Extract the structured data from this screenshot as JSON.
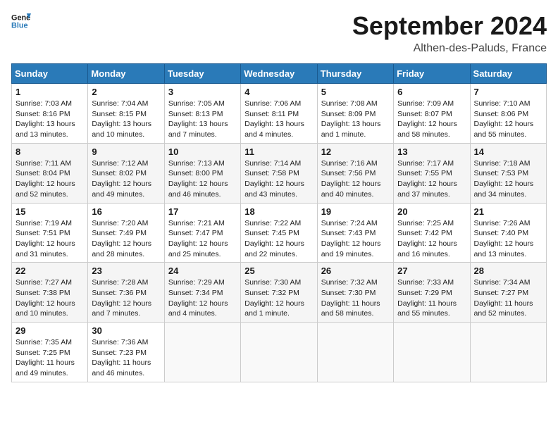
{
  "header": {
    "logo_line1": "General",
    "logo_line2": "Blue",
    "month_year": "September 2024",
    "location": "Althen-des-Paluds, France"
  },
  "weekdays": [
    "Sunday",
    "Monday",
    "Tuesday",
    "Wednesday",
    "Thursday",
    "Friday",
    "Saturday"
  ],
  "weeks": [
    [
      {
        "day": "1",
        "info": "Sunrise: 7:03 AM\nSunset: 8:16 PM\nDaylight: 13 hours\nand 13 minutes."
      },
      {
        "day": "2",
        "info": "Sunrise: 7:04 AM\nSunset: 8:15 PM\nDaylight: 13 hours\nand 10 minutes."
      },
      {
        "day": "3",
        "info": "Sunrise: 7:05 AM\nSunset: 8:13 PM\nDaylight: 13 hours\nand 7 minutes."
      },
      {
        "day": "4",
        "info": "Sunrise: 7:06 AM\nSunset: 8:11 PM\nDaylight: 13 hours\nand 4 minutes."
      },
      {
        "day": "5",
        "info": "Sunrise: 7:08 AM\nSunset: 8:09 PM\nDaylight: 13 hours\nand 1 minute."
      },
      {
        "day": "6",
        "info": "Sunrise: 7:09 AM\nSunset: 8:07 PM\nDaylight: 12 hours\nand 58 minutes."
      },
      {
        "day": "7",
        "info": "Sunrise: 7:10 AM\nSunset: 8:06 PM\nDaylight: 12 hours\nand 55 minutes."
      }
    ],
    [
      {
        "day": "8",
        "info": "Sunrise: 7:11 AM\nSunset: 8:04 PM\nDaylight: 12 hours\nand 52 minutes."
      },
      {
        "day": "9",
        "info": "Sunrise: 7:12 AM\nSunset: 8:02 PM\nDaylight: 12 hours\nand 49 minutes."
      },
      {
        "day": "10",
        "info": "Sunrise: 7:13 AM\nSunset: 8:00 PM\nDaylight: 12 hours\nand 46 minutes."
      },
      {
        "day": "11",
        "info": "Sunrise: 7:14 AM\nSunset: 7:58 PM\nDaylight: 12 hours\nand 43 minutes."
      },
      {
        "day": "12",
        "info": "Sunrise: 7:16 AM\nSunset: 7:56 PM\nDaylight: 12 hours\nand 40 minutes."
      },
      {
        "day": "13",
        "info": "Sunrise: 7:17 AM\nSunset: 7:55 PM\nDaylight: 12 hours\nand 37 minutes."
      },
      {
        "day": "14",
        "info": "Sunrise: 7:18 AM\nSunset: 7:53 PM\nDaylight: 12 hours\nand 34 minutes."
      }
    ],
    [
      {
        "day": "15",
        "info": "Sunrise: 7:19 AM\nSunset: 7:51 PM\nDaylight: 12 hours\nand 31 minutes."
      },
      {
        "day": "16",
        "info": "Sunrise: 7:20 AM\nSunset: 7:49 PM\nDaylight: 12 hours\nand 28 minutes."
      },
      {
        "day": "17",
        "info": "Sunrise: 7:21 AM\nSunset: 7:47 PM\nDaylight: 12 hours\nand 25 minutes."
      },
      {
        "day": "18",
        "info": "Sunrise: 7:22 AM\nSunset: 7:45 PM\nDaylight: 12 hours\nand 22 minutes."
      },
      {
        "day": "19",
        "info": "Sunrise: 7:24 AM\nSunset: 7:43 PM\nDaylight: 12 hours\nand 19 minutes."
      },
      {
        "day": "20",
        "info": "Sunrise: 7:25 AM\nSunset: 7:42 PM\nDaylight: 12 hours\nand 16 minutes."
      },
      {
        "day": "21",
        "info": "Sunrise: 7:26 AM\nSunset: 7:40 PM\nDaylight: 12 hours\nand 13 minutes."
      }
    ],
    [
      {
        "day": "22",
        "info": "Sunrise: 7:27 AM\nSunset: 7:38 PM\nDaylight: 12 hours\nand 10 minutes."
      },
      {
        "day": "23",
        "info": "Sunrise: 7:28 AM\nSunset: 7:36 PM\nDaylight: 12 hours\nand 7 minutes."
      },
      {
        "day": "24",
        "info": "Sunrise: 7:29 AM\nSunset: 7:34 PM\nDaylight: 12 hours\nand 4 minutes."
      },
      {
        "day": "25",
        "info": "Sunrise: 7:30 AM\nSunset: 7:32 PM\nDaylight: 12 hours\nand 1 minute."
      },
      {
        "day": "26",
        "info": "Sunrise: 7:32 AM\nSunset: 7:30 PM\nDaylight: 11 hours\nand 58 minutes."
      },
      {
        "day": "27",
        "info": "Sunrise: 7:33 AM\nSunset: 7:29 PM\nDaylight: 11 hours\nand 55 minutes."
      },
      {
        "day": "28",
        "info": "Sunrise: 7:34 AM\nSunset: 7:27 PM\nDaylight: 11 hours\nand 52 minutes."
      }
    ],
    [
      {
        "day": "29",
        "info": "Sunrise: 7:35 AM\nSunset: 7:25 PM\nDaylight: 11 hours\nand 49 minutes."
      },
      {
        "day": "30",
        "info": "Sunrise: 7:36 AM\nSunset: 7:23 PM\nDaylight: 11 hours\nand 46 minutes."
      },
      {
        "day": "",
        "info": ""
      },
      {
        "day": "",
        "info": ""
      },
      {
        "day": "",
        "info": ""
      },
      {
        "day": "",
        "info": ""
      },
      {
        "day": "",
        "info": ""
      }
    ]
  ]
}
